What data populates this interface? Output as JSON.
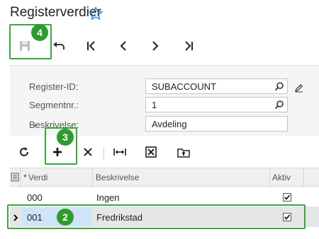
{
  "page": {
    "title": "Registerverdier"
  },
  "form": {
    "register_id_label": "Register-ID:",
    "register_id_value": "SUBACCOUNT",
    "segment_label": "Segmentnr.:",
    "segment_value": "1",
    "description_label": "Beskrivelse:",
    "description_value": "Avdeling",
    "required_marker": "*"
  },
  "grid": {
    "columns": [
      {
        "label": "Verdi",
        "required": "*"
      },
      {
        "label": "Beskrivelse"
      },
      {
        "label": "Aktiv"
      }
    ],
    "rows": [
      {
        "value": "000",
        "description": "Ingen",
        "active": true
      },
      {
        "value": "001",
        "description": "Fredrikstad",
        "active": true
      }
    ]
  },
  "callouts": [
    "4",
    "3",
    "2"
  ],
  "icons": {
    "main_toolbar": [
      "save-icon",
      "undo-icon",
      "first-record-icon",
      "previous-record-icon",
      "next-record-icon",
      "last-record-icon"
    ],
    "grid_toolbar": [
      "refresh-icon",
      "add-row-icon",
      "delete-row-icon",
      "fit-columns-icon",
      "export-excel-icon",
      "upload-icon"
    ]
  },
  "colors": {
    "accent": "#2f9b2f",
    "selected_cell": "#cfe4f7",
    "selected_row": "#e6e6e6",
    "star": "#2e86de"
  }
}
